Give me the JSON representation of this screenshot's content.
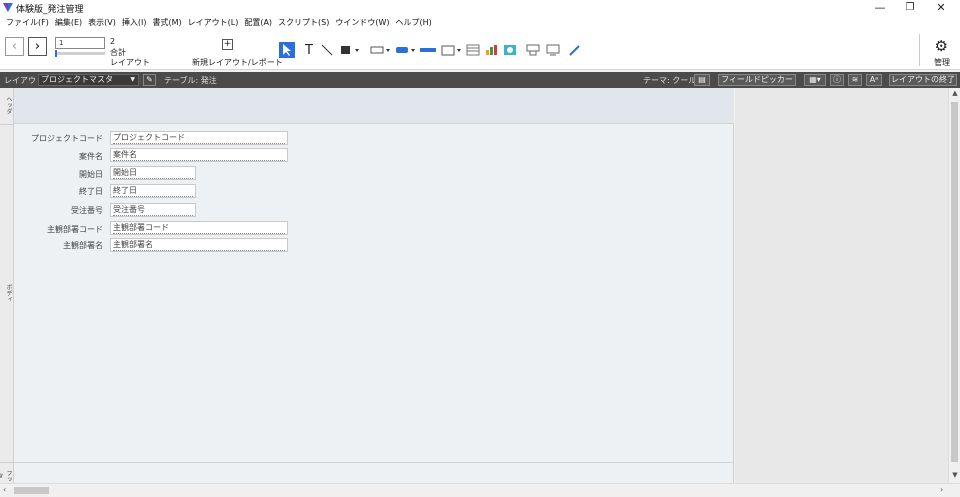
{
  "window": {
    "title": "体験版_発注管理",
    "controls": {
      "minimize": "—",
      "restore": "❐",
      "close": "✕"
    }
  },
  "menubar": [
    "ファイル(F)",
    "編集(E)",
    "表示(V)",
    "挿入(I)",
    "書式(M)",
    "レイアウト(L)",
    "配置(A)",
    "スクリプト(S)",
    "ウインドウ(W)",
    "ヘルプ(H)"
  ],
  "toolbar": {
    "record_value": "1",
    "total_count": "2",
    "total_label": "合計",
    "mode_label": "レイアウト",
    "new_layout_label": "新規レイアウト/レポート",
    "manage_label": "管理"
  },
  "layoutbar": {
    "layout_label": "レイアウト:",
    "layout_name": "プロジェクトマスタ",
    "table_label": "テーブル: 発注",
    "theme_label": "テーマ: クール",
    "field_picker": "フィールドピッカー",
    "exit_layout": "レイアウトの終了"
  },
  "parts": {
    "header": "ヘッダ",
    "body": "ボディ",
    "footer": "フッタ"
  },
  "fields": [
    {
      "label": "プロジェクトコード",
      "value": "プロジェクトコード"
    },
    {
      "label": "案件名",
      "value": "案件名"
    },
    {
      "label": "開始日",
      "value": "開始日"
    },
    {
      "label": "終了日",
      "value": "終了日"
    },
    {
      "label": "受注番号",
      "value": "受注番号"
    },
    {
      "label": "主観部署コード",
      "value": "主観部署コード"
    },
    {
      "label": "主観部署名",
      "value": "主観部署名"
    }
  ],
  "colors": {
    "accent": "#2a6fdb",
    "layoutbar_bg": "#4b4b4b",
    "canvas_bg": "#eef1f4",
    "header_part_bg": "#e1e6ec"
  }
}
